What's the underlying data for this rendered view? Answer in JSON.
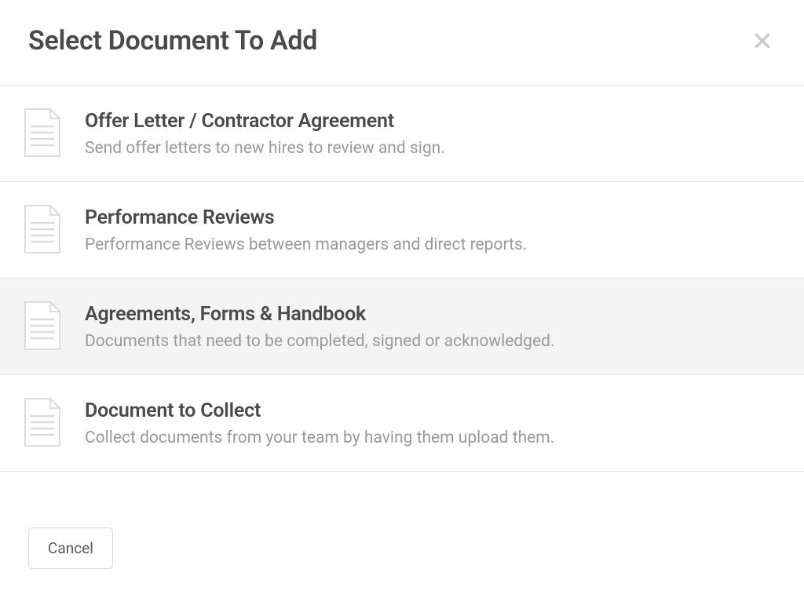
{
  "modal": {
    "title": "Select Document To Add",
    "options": [
      {
        "title": "Offer Letter / Contractor Agreement",
        "description": "Send offer letters to new hires to review and sign."
      },
      {
        "title": "Performance Reviews",
        "description": "Performance Reviews between managers and direct reports."
      },
      {
        "title": "Agreements, Forms & Handbook",
        "description": "Documents that need to be completed, signed or acknowledged."
      },
      {
        "title": "Document to Collect",
        "description": "Collect documents from your team by having them upload them."
      }
    ],
    "cancel_label": "Cancel"
  }
}
